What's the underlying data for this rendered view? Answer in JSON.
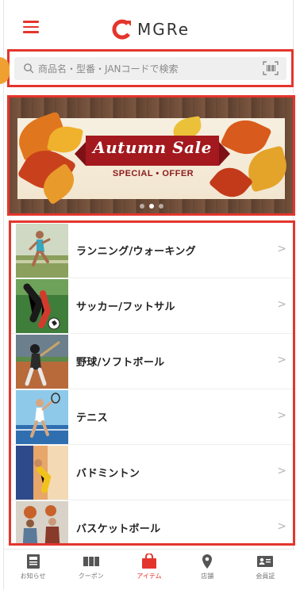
{
  "header": {
    "menu_icon": "hamburger-icon",
    "logo_text": "MGRe",
    "accent_color": "#e4352c"
  },
  "search": {
    "placeholder": "商品名・型番・JANコードで検索",
    "scan_icon": "barcode-scan-icon"
  },
  "banner": {
    "title": "Autumn Sale",
    "subtitle": "SPECIAL • OFFER",
    "slides": 3,
    "active_slide": 1
  },
  "categories": [
    {
      "label": "ランニング/ウォーキング",
      "icon": "running-thumbnail"
    },
    {
      "label": "サッカー/フットサル",
      "icon": "soccer-thumbnail"
    },
    {
      "label": "野球/ソフトボール",
      "icon": "baseball-thumbnail"
    },
    {
      "label": "テニス",
      "icon": "tennis-thumbnail"
    },
    {
      "label": "バドミントン",
      "icon": "badminton-thumbnail"
    },
    {
      "label": "バスケットボール",
      "icon": "basketball-thumbnail"
    }
  ],
  "chevron": ">",
  "tabbar": {
    "items": [
      {
        "label": "お知らせ",
        "icon": "news-icon"
      },
      {
        "label": "クーポン",
        "icon": "coupon-icon"
      },
      {
        "label": "アイテム",
        "icon": "shopping-bag-icon"
      },
      {
        "label": "店舗",
        "icon": "map-pin-icon"
      },
      {
        "label": "会員証",
        "icon": "member-card-icon"
      }
    ],
    "active_index": 2
  }
}
